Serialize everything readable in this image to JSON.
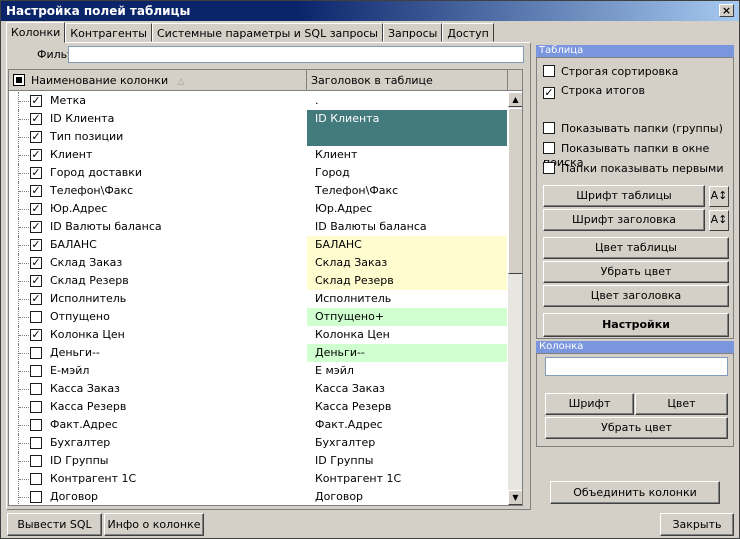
{
  "window": {
    "title": "Настройка полей таблицы",
    "close_glyph": "×"
  },
  "tabs": [
    {
      "label": "Колонки",
      "active": true
    },
    {
      "label": "Контрагенты"
    },
    {
      "label": "Системные параметры и SQL запросы"
    },
    {
      "label": "Запросы"
    },
    {
      "label": "Доступ"
    }
  ],
  "filter": {
    "label": "Фильтр",
    "value": ""
  },
  "grid": {
    "headers": [
      "Наименование колонки",
      "Заголовок в таблице"
    ],
    "sort_glyph": "△",
    "rows": [
      {
        "name": "Метка",
        "checked": true,
        "header": ".",
        "color": ""
      },
      {
        "name": "ID Клиента",
        "checked": true,
        "header": "ID Клиента",
        "color": "teal"
      },
      {
        "name": "Тип позиции",
        "checked": true,
        "header": "",
        "color": ""
      },
      {
        "name": "Клиент",
        "checked": true,
        "header": "Клиент",
        "color": ""
      },
      {
        "name": "Город доставки",
        "checked": true,
        "header": "Город",
        "color": ""
      },
      {
        "name": "Телефон\\Факс",
        "checked": true,
        "header": "Телефон\\Факс",
        "color": ""
      },
      {
        "name": "Юр.Адрес",
        "checked": true,
        "header": "Юр.Адрес",
        "color": ""
      },
      {
        "name": "ID Валюты баланса",
        "checked": true,
        "header": "ID Валюты баланса",
        "color": ""
      },
      {
        "name": "БАЛАНС",
        "checked": true,
        "header": "БАЛАНС",
        "color": "yellow"
      },
      {
        "name": "Склад Заказ",
        "checked": true,
        "header": "Склад Заказ",
        "color": "yellow"
      },
      {
        "name": "Склад Резерв",
        "checked": true,
        "header": "Склад Резерв",
        "color": "yellow"
      },
      {
        "name": "Исполнитель",
        "checked": true,
        "header": "Исполнитель",
        "color": ""
      },
      {
        "name": "Отпущено",
        "checked": false,
        "header": "Отпущено+",
        "color": "green"
      },
      {
        "name": "Колонка Цен",
        "checked": true,
        "header": "Колонка Цен",
        "color": ""
      },
      {
        "name": "Деньги--",
        "checked": false,
        "header": "Деньги--",
        "color": "green"
      },
      {
        "name": "E-мэйл",
        "checked": false,
        "header": "E мэйл",
        "color": ""
      },
      {
        "name": "Касса Заказ",
        "checked": false,
        "header": "Касса Заказ",
        "color": ""
      },
      {
        "name": "Касса Резерв",
        "checked": false,
        "header": "Касса Резерв",
        "color": ""
      },
      {
        "name": "Факт.Адрес",
        "checked": false,
        "header": "Факт.Адрес",
        "color": ""
      },
      {
        "name": "Бухгалтер",
        "checked": false,
        "header": "Бухгалтер",
        "color": ""
      },
      {
        "name": "ID Группы",
        "checked": false,
        "header": "ID Группы",
        "color": ""
      },
      {
        "name": "Контрагент 1С",
        "checked": false,
        "header": "Контрагент 1С",
        "color": ""
      },
      {
        "name": "Договор",
        "checked": false,
        "header": "Договор",
        "color": ""
      }
    ],
    "scroll_up_glyph": "▲",
    "scroll_down_glyph": "▼",
    "check_glyph": "✓"
  },
  "table_group": {
    "title": "Таблица",
    "options": [
      {
        "label": "Строгая сортировка",
        "checked": false
      },
      {
        "label": "Строка итогов",
        "checked": true
      },
      {
        "label": "Показывать папки (группы)",
        "checked": false
      },
      {
        "label": "Показывать папки в окне поиска",
        "checked": false
      },
      {
        "label": "Папки показывать первыми",
        "checked": false
      }
    ],
    "btn_font_table": "Шрифт таблицы",
    "btn_font_header": "Шрифт заголовка",
    "btn_table_color": "Цвет таблицы",
    "btn_remove_color": "Убрать цвет",
    "btn_header_color": "Цвет заголовка",
    "btn_settings": "Настройки",
    "font_size_glyph": "A↕"
  },
  "column_group": {
    "title": "Колонка",
    "value": "",
    "btn_font": "Шрифт",
    "btn_color": "Цвет",
    "btn_remove_color": "Убрать цвет",
    "btn_merge": "Объединить колонки"
  },
  "footer": {
    "btn_sql": "Вывести SQL",
    "btn_info": "Инфо о колонке",
    "btn_close": "Закрыть"
  },
  "colors": {
    "teal": "#437b7d",
    "yellow": "#fffdd0",
    "green": "#d0ffd0",
    "group_title": "#7a96df"
  }
}
